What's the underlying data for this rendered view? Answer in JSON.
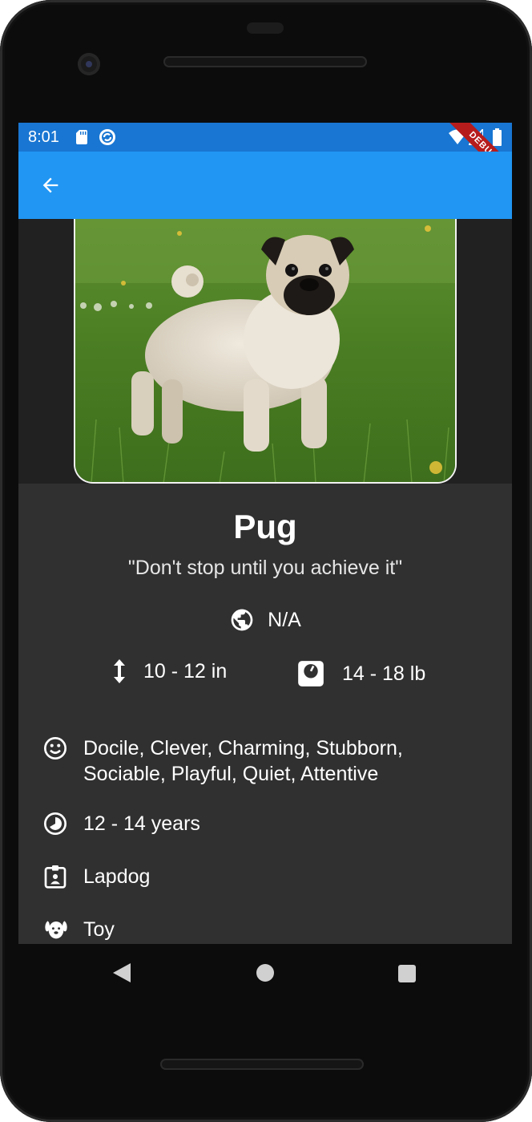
{
  "status_bar": {
    "time": "8:01",
    "debug_banner": "DEBUG",
    "icons": [
      "sd-card-icon",
      "sync-icon",
      "wifi-icon",
      "signal-icon",
      "battery-icon"
    ]
  },
  "app_bar": {
    "back_icon": "arrow-back-icon",
    "color": "#2196F3"
  },
  "breed": {
    "image_subject": "pug-photo",
    "name": "Pug",
    "motto": "\"Don't stop until you achieve it\"",
    "origin": "N/A",
    "height": "10 - 12 in",
    "weight": "14 - 18 lb",
    "temperament": "Docile, Clever, Charming, Stubborn, Sociable, Playful, Quiet, Attentive",
    "life_span": "12 - 14 years",
    "bred_for": "Lapdog",
    "group": "Toy"
  },
  "nav_bar": {
    "icons": [
      "nav-back-icon",
      "nav-home-icon",
      "nav-recent-icon"
    ]
  },
  "colors": {
    "status_bar": "#1976D2",
    "app_bar": "#2196F3",
    "background": "#303030",
    "debug_ribbon": "#B71C1C"
  }
}
